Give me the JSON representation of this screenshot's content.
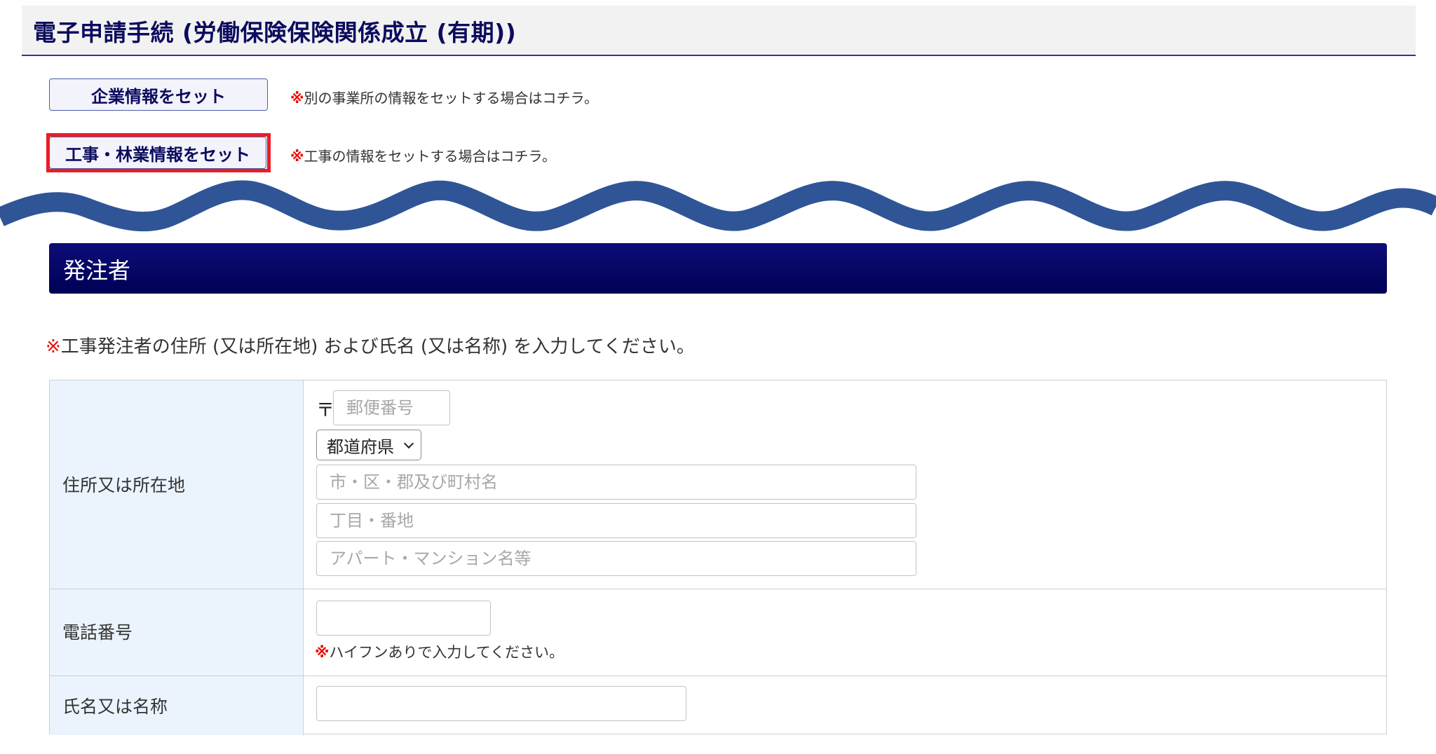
{
  "header": {
    "title": "電子申請手続 (労働保険保険関係成立 (有期))"
  },
  "set_buttons": {
    "company": {
      "label": "企業情報をセット",
      "note_mark": "※",
      "note": "別の事業所の情報をセットする場合はコチラ。"
    },
    "construction": {
      "label": "工事・林業情報をセット",
      "note_mark": "※",
      "note": "工事の情報をセットする場合はコチラ。"
    }
  },
  "section": {
    "title": "発注者",
    "instruction_mark": "※",
    "instruction": "工事発注者の住所 (又は所在地) および氏名 (又は名称) を入力してください。"
  },
  "form": {
    "address": {
      "label": "住所又は所在地",
      "postal_mark": "〒",
      "postal_placeholder": "郵便番号",
      "prefecture_selected": "都道府県",
      "city_placeholder": "市・区・郡及び町村名",
      "street_placeholder": "丁目・番地",
      "building_placeholder": "アパート・マンション名等"
    },
    "phone": {
      "label": "電話番号",
      "value": "",
      "note_mark": "※",
      "note": "ハイフンありで入力してください。"
    },
    "name": {
      "label": "氏名又は名称",
      "value": ""
    }
  },
  "colors": {
    "title_text": "#0b0b5e",
    "section_bar": "#000055",
    "wave": "#2f5597",
    "highlight": "#ec1c24",
    "label_bg": "#ebf4fd",
    "note_mark": "#e8120c"
  }
}
